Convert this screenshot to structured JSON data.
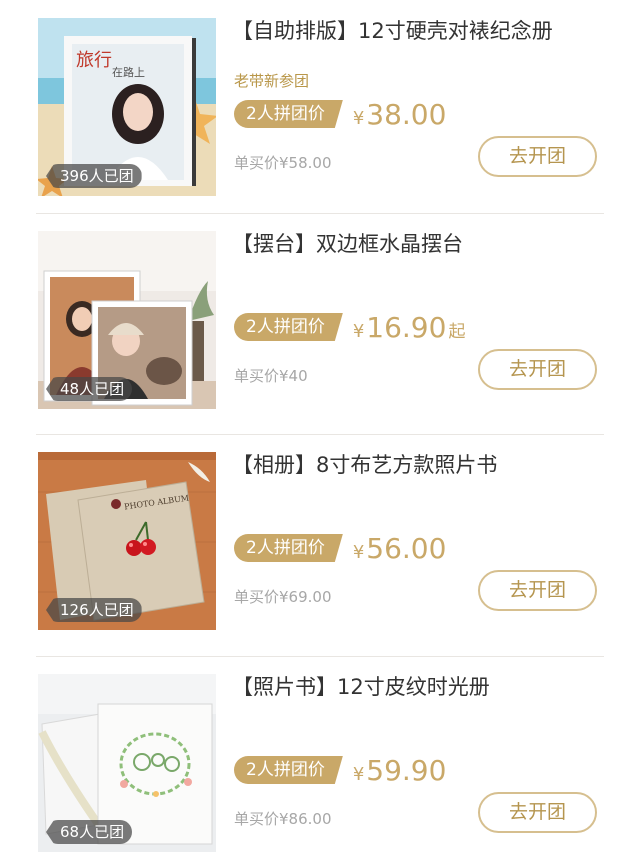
{
  "products": [
    {
      "title": "【自助排版】12寸硬壳对裱纪念册",
      "tag": "老带新参团",
      "badge": "2人拼团价",
      "currency": "¥",
      "price": "38.00",
      "price_suffix": "",
      "single_price": "单买价¥58.00",
      "sold": "396人已团",
      "button": "去开团",
      "cover_title": "旅行",
      "cover_subtitle": "在路上"
    },
    {
      "title": "【摆台】双边框水晶摆台",
      "tag": "",
      "badge": "2人拼团价",
      "currency": "¥",
      "price": "16.90",
      "price_suffix": "起",
      "single_price": "单买价¥40",
      "sold": "48人已团",
      "button": "去开团"
    },
    {
      "title": "【相册】8寸布艺方款照片书",
      "tag": "",
      "badge": "2人拼团价",
      "currency": "¥",
      "price": "56.00",
      "price_suffix": "",
      "single_price": "单买价¥69.00",
      "sold": "126人已团",
      "button": "去开团",
      "cover_title": "PHOTO ALBUM"
    },
    {
      "title": "【照片书】12寸皮纹时光册",
      "tag": "",
      "badge": "2人拼团价",
      "currency": "¥",
      "price": "59.90",
      "price_suffix": "",
      "single_price": "单买价¥86.00",
      "sold": "68人已团",
      "button": "去开团"
    }
  ],
  "colors": {
    "accent": "#c9a868",
    "button_border": "#d6bf8f",
    "title": "#333333",
    "muted": "#a7a7a7"
  }
}
